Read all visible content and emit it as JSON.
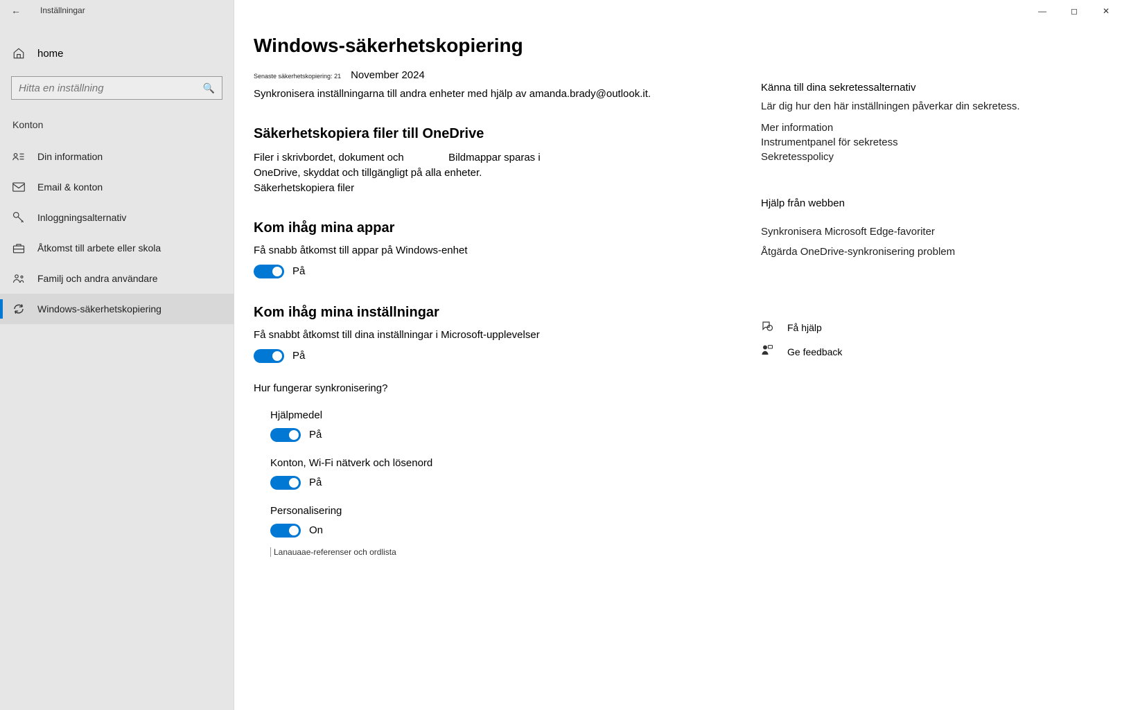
{
  "app": {
    "title": "Inställningar"
  },
  "sidebar": {
    "home_label": "home",
    "search_placeholder": "Hitta en inställning",
    "category": "Konton",
    "items": [
      {
        "label": "Din information"
      },
      {
        "label": "Email &amp; konton"
      },
      {
        "label": "Inloggningsalternativ"
      },
      {
        "label": "Åtkomst till arbete eller skola"
      },
      {
        "label": "Familj och andra användare"
      },
      {
        "label": "Windows-säkerhetskopiering"
      }
    ]
  },
  "page": {
    "title": "Windows-säkerhetskopiering",
    "last_backup_label": "Senaste säkerhetskopiering: 21",
    "last_backup_date": "November 2024",
    "sync_text": "Synkronisera inställningarna till andra enheter med hjälp av amanda.brady@outlook.it."
  },
  "onedrive": {
    "heading": "Säkerhetskopiera filer till OneDrive",
    "body_p1": "Filer i skrivbordet, dokument och",
    "body_p2": "Bildmappar sparas i",
    "body_p3": "OneDrive, skyddat och tillgängligt på alla enheter.",
    "link": "Säkerhetskopiera filer"
  },
  "apps": {
    "heading": "Kom ihåg mina appar",
    "desc": "Få snabb åtkomst till appar på Windows-enhet",
    "state": "På"
  },
  "settings": {
    "heading": "Kom ihåg mina inställningar",
    "desc": "Få snabbt åtkomst till dina inställningar i Microsoft-upplevelser",
    "state": "På",
    "howworks": "Hur fungerar synkronisering?",
    "subs": [
      {
        "label": "Hjälpmedel",
        "state": "På"
      },
      {
        "label": "Konton, Wi-Fi nätverk och lösenord",
        "state": "På"
      },
      {
        "label": "Personalisering",
        "state": "On"
      }
    ],
    "lang_item": "Lanauaae-referenser och ordlista"
  },
  "right": {
    "privacy_h": "Känna till dina sekretessalternativ",
    "privacy_text": "Lär dig hur den här inställningen påverkar din sekretess.",
    "links1": [
      "Mer information",
      "Instrumentpanel för sekretess",
      "Sekretesspolicy"
    ],
    "help_h": "Hjälp från webben",
    "links2": [
      "Synkronisera Microsoft Edge-favoriter",
      "Åtgärda OneDrive-synkronisering problem"
    ],
    "get_help": "Få hjälp",
    "feedback": "Ge feedback"
  }
}
